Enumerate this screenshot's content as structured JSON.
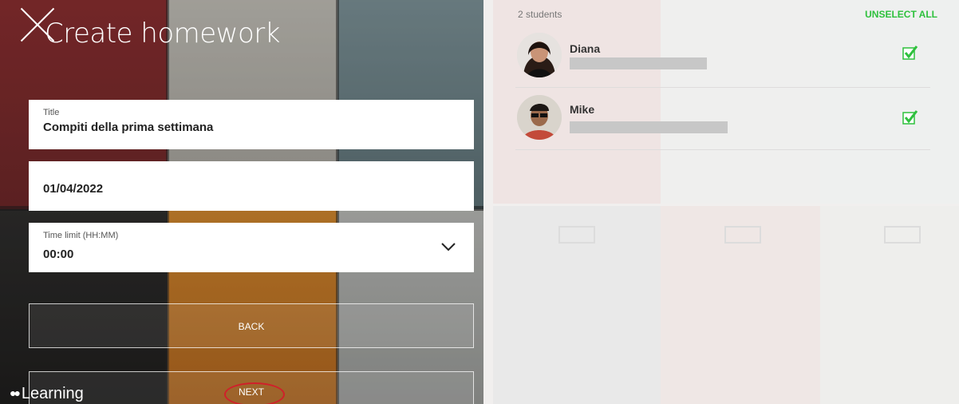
{
  "header": {
    "title": "Create homework"
  },
  "form": {
    "title_label": "Title",
    "title_value": "Compiti della prima settimana",
    "date_value": "01/04/2022",
    "time_label": "Time limit (HH:MM)",
    "time_value": "00:00"
  },
  "buttons": {
    "back": "BACK",
    "next": "NEXT"
  },
  "brand": {
    "name": "Learning"
  },
  "students": {
    "count_label": "2 students",
    "unselect_all": "UNSELECT ALL",
    "items": [
      {
        "name": "Diana",
        "selected": true
      },
      {
        "name": "Mike",
        "selected": true
      }
    ]
  },
  "colors": {
    "accent_green": "#2ec13d",
    "annotation_red": "#d0202a"
  }
}
